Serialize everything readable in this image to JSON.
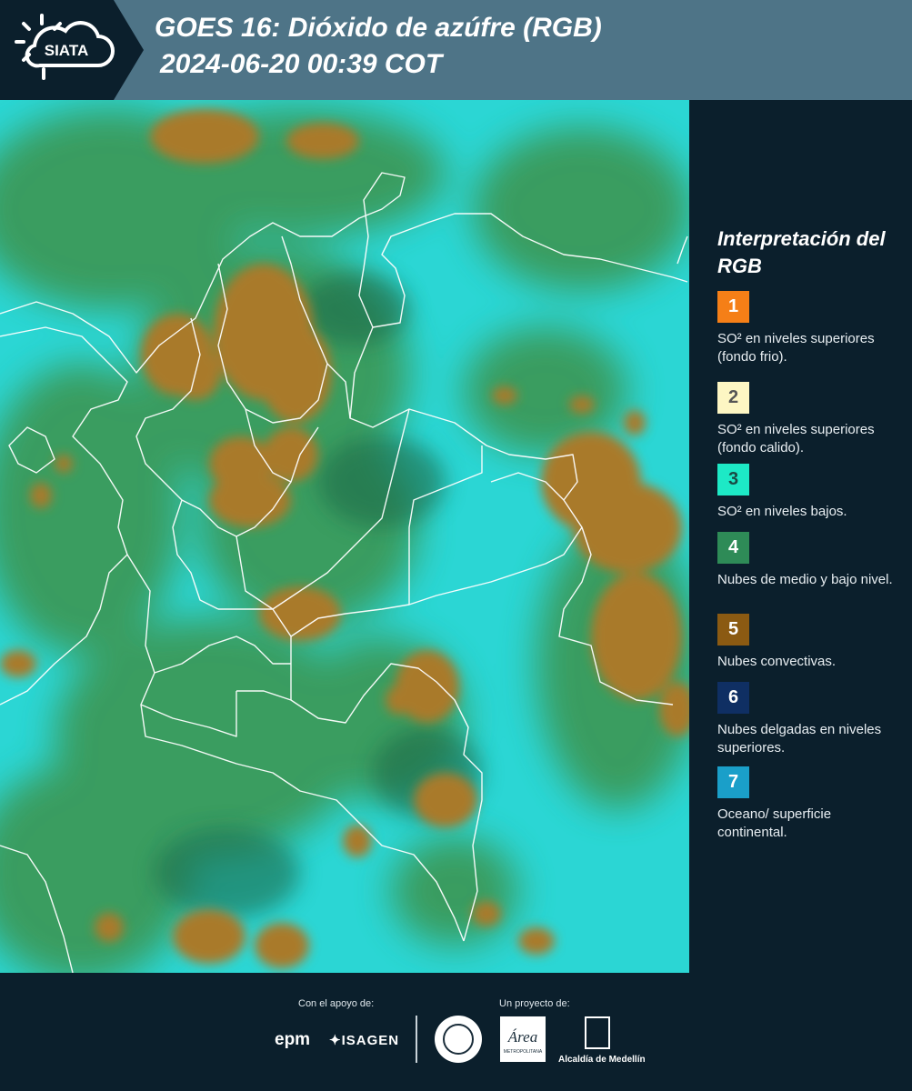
{
  "header": {
    "logo_text": "SIATA",
    "title": "GOES 16: Dióxido de azúfre (RGB)",
    "subtitle": "2024-06-20 00:39 COT"
  },
  "legend": {
    "title": "Interpretación del RGB",
    "items": [
      {
        "number": "1",
        "label": "SO² en niveles superiores (fondo frio).",
        "color": "#f57f17",
        "text_color": "#ffffff"
      },
      {
        "number": "2",
        "label": "SO² en niveles superiores (fondo calido).",
        "color": "#fdf6c3",
        "text_color": "#555555"
      },
      {
        "number": "3",
        "label": "SO² en niveles bajos.",
        "color": "#1de9c6",
        "text_color": "#1a4a44"
      },
      {
        "number": "4",
        "label": "Nubes de medio y bajo nivel.",
        "color": "#2e8b57",
        "text_color": "#ffffff"
      },
      {
        "number": "5",
        "label": "Nubes convectivas.",
        "color": "#8b5a12",
        "text_color": "#ffffff"
      },
      {
        "number": "6",
        "label": "Nubes delgadas en niveles superiores.",
        "color": "#0f2f63",
        "text_color": "#ffffff"
      },
      {
        "number": "7",
        "label": "Oceano/ superficie continental.",
        "color": "#1a9fc9",
        "text_color": "#ffffff"
      }
    ]
  },
  "footer": {
    "support_label": "Con el apoyo de:",
    "project_label": "Un proyecto de:",
    "sponsor_1": "epm",
    "sponsor_2": "ISAGEN",
    "area_logo_text": "Área",
    "area_logo_subtext": "METROPOLITANA",
    "alcaldia": "Alcaldía de Medellín"
  },
  "colors": {
    "header_band": "#4e7487",
    "background": "#0b1f2c",
    "ocean_cyan": "#2bd6d4",
    "low_cloud_green": "#3a9a5a",
    "convective_brown": "#a97a2c"
  }
}
